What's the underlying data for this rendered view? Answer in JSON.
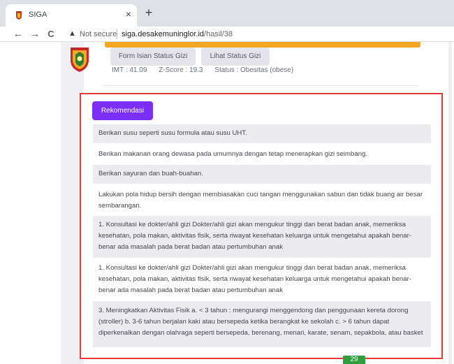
{
  "browser": {
    "tab_title": "SIGA",
    "tab_close": "×",
    "new_tab": "+",
    "back": "←",
    "forward": "→",
    "reload": "C",
    "warning_icon_glyph": "▲",
    "not_secure": "Not secure",
    "url_host": "siga.desakemuninglor.id",
    "url_path": "/hasil/38"
  },
  "header": {
    "form_button": "Form Isian Status Gizi",
    "lihat_button": "Lihat Status Gizi",
    "imt": "IMT : 41.09",
    "zscore": "Z-Score : 19.3",
    "status": "Status : Obesitas (obese)"
  },
  "recommendation": {
    "badge": "Rekomendasi",
    "items": [
      "Berikan susu seperti susu formula atau susu UHT.",
      "Berikan makanan orang dewasa pada umumnya dengan tetap menerapkan gizi seimbang.",
      "Berikan sayuran dan buah-buahan.",
      "Lakukan pola hidup bersih dengan membiasakan cuci tangan menggunakan sabun dan tidak buang air besar sembarangan.",
      "1. Konsultasi ke dokter/ahli gizi Dokter/ahli gizi akan mengukur tinggi dan berat badan anak, memeriksa kesehatan, pola makan, aktivitas fisik, serta riwayat kesehatan keluarga untuk mengetahui apakah benar-benar ada masalah pada berat badan atau pertumbuhan anak",
      "1. Konsultasi ke dokter/ahli gizi Dokter/ahli gizi akan mengukur tinggi dan berat badan anak, memeriksa kesehatan, pola makan, aktivitas fisik, serta riwayat kesehatan keluarga untuk mengetahui apakah benar-benar ada masalah pada berat badan atau pertumbuhan anak",
      "3. Meningkatkan Aktivitas Fisik a. < 3 tahun : mengurangi menggendong dan penggunaan kereta dorong (stroller) b. 3-6 tahun berjalan kaki atau bersepeda ketika berangkat ke sekolah c. > 6 tahun dapat diperkenalkan dengan olahraga seperti bersepeda, berenang, menari, karate, senam, sepakbola, atau basket"
    ]
  },
  "page_badge": "29",
  "colors": {
    "accent": "#f5a623",
    "badge_purple": "#7b2ff7",
    "highlight_red": "#e53935",
    "page_badge_green": "#2e9e3f"
  }
}
